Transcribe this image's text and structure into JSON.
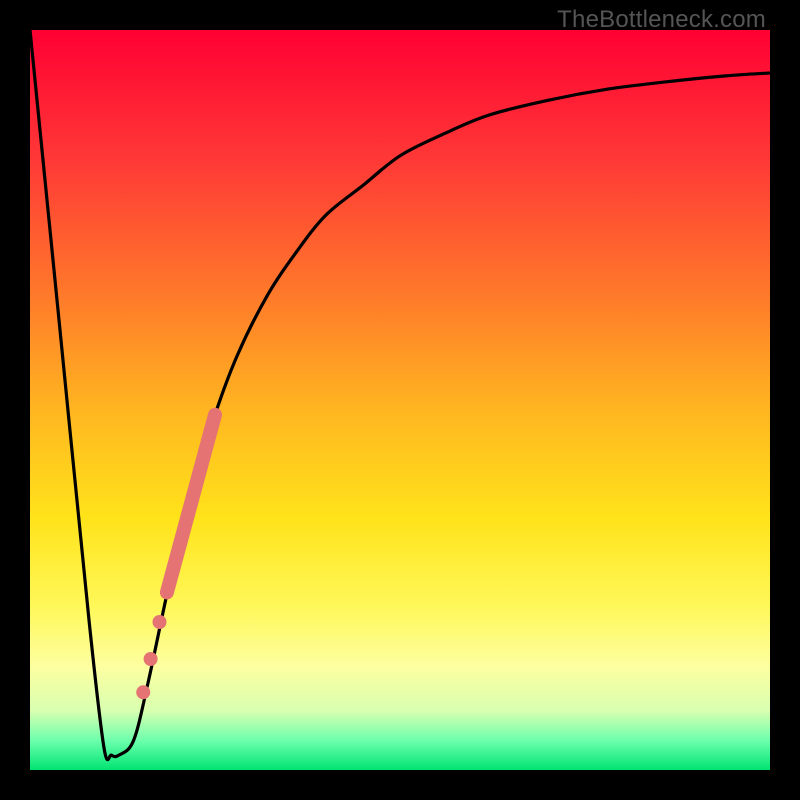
{
  "watermark": "TheBottleneck.com",
  "colors": {
    "frame": "#000000",
    "curve": "#000000",
    "marker_fill": "#e57373",
    "marker_stroke": "#d66"
  },
  "chart_data": {
    "type": "line",
    "title": "",
    "xlabel": "",
    "ylabel": "",
    "xlim": [
      0,
      100
    ],
    "ylim": [
      0,
      100
    ],
    "grid": false,
    "legend": false,
    "series": [
      {
        "name": "bottleneck_curve",
        "x": [
          0,
          4,
          8,
          10,
          11,
          12,
          14,
          16,
          19,
          22,
          25,
          28,
          32,
          36,
          40,
          45,
          50,
          56,
          62,
          70,
          78,
          86,
          94,
          100
        ],
        "y": [
          100,
          60,
          20,
          3,
          2,
          2,
          4,
          12,
          26,
          38,
          48,
          56,
          64,
          70,
          75,
          79,
          83,
          86,
          88.5,
          90.5,
          92,
          93,
          93.8,
          94.2
        ]
      }
    ],
    "markers": [
      {
        "name": "segment",
        "x0": 18.5,
        "y0": 24.0,
        "x1": 25.0,
        "y1": 48.0,
        "width": 14
      },
      {
        "name": "dot",
        "x": 17.5,
        "y": 20.0,
        "r": 7
      },
      {
        "name": "dot",
        "x": 16.3,
        "y": 15.0,
        "r": 7
      },
      {
        "name": "dot",
        "x": 15.3,
        "y": 10.5,
        "r": 7
      }
    ],
    "annotations": []
  }
}
